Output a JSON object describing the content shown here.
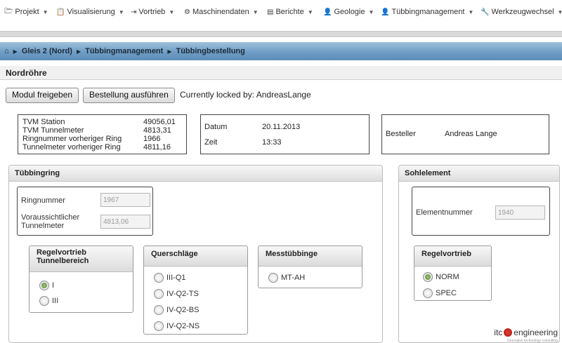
{
  "menu": [
    {
      "icon": "folder-icon",
      "glyph": "🗁",
      "label": "Projekt"
    },
    {
      "icon": "clipboard-icon",
      "glyph": "📋",
      "label": "Visualisierung"
    },
    {
      "icon": "arrow-right-icon",
      "glyph": "⇥",
      "label": "Vortrieb"
    },
    {
      "icon": "gear-icon",
      "glyph": "⚙",
      "label": "Maschinendaten"
    },
    {
      "icon": "report-icon",
      "glyph": "▤",
      "label": "Berichte"
    },
    {
      "icon": "person-icon",
      "glyph": "👤",
      "label": "Geologie"
    },
    {
      "icon": "person-icon",
      "glyph": "👤",
      "label": "Tübbingmanagement"
    },
    {
      "icon": "wrench-icon",
      "glyph": "🔧",
      "label": "Werkzeugwechsel"
    }
  ],
  "breadcrumb": [
    "Gleis 2 (Nord)",
    "Tübbingmanagement",
    "Tübbingbestellung"
  ],
  "page_title": "Nordröhre",
  "toolbar": {
    "release_label": "Modul freigeben",
    "order_label": "Bestellung ausführen",
    "lock_text": "Currently locked by: AndreasLange"
  },
  "tvm": [
    {
      "label": "TVM Station",
      "value": "49056,01"
    },
    {
      "label": "TVM Tunnelmeter",
      "value": "4813,31"
    },
    {
      "label": "Ringnummer vorheriger Ring",
      "value": "1966"
    },
    {
      "label": "Tunnelmeter vorheriger Ring",
      "value": "4811,16"
    }
  ],
  "datetime": {
    "date_label": "Datum",
    "date_value": "20.11.2013",
    "time_label": "Zeit",
    "time_value": "13:33"
  },
  "besteller": {
    "label": "Besteller",
    "value": "Andreas Lange"
  },
  "tuebbingring": {
    "title": "Tübbingring",
    "ring_label": "Ringnummer",
    "ring_value": "1967",
    "tm_label": "Voraussichtlicher Tunnelmeter",
    "tm_value": "4813,06",
    "regel": {
      "title": "Regelvortrieb Tunnelbereich",
      "options": [
        "I",
        "III"
      ],
      "selected": 0
    },
    "quer": {
      "title": "Querschläge",
      "options": [
        "III-Q1",
        "IV-Q2-TS",
        "IV-Q2-BS",
        "IV-Q2-NS"
      ]
    },
    "mess": {
      "title": "Messtübbinge",
      "options": [
        "MT-AH"
      ]
    }
  },
  "sohl": {
    "title": "Sohlelement",
    "element_label": "Elementnummer",
    "element_value": "1940",
    "regel": {
      "title": "Regelvortrieb",
      "options": [
        "NORM",
        "SPEC"
      ],
      "selected": 0
    }
  },
  "logo": {
    "prefix": "itc",
    "suffix": "engineering",
    "tagline": "innovative technology consulting"
  },
  "colors": {
    "accent_blue": "#6f9dc4",
    "radio_selected": "#5f8f3a"
  }
}
